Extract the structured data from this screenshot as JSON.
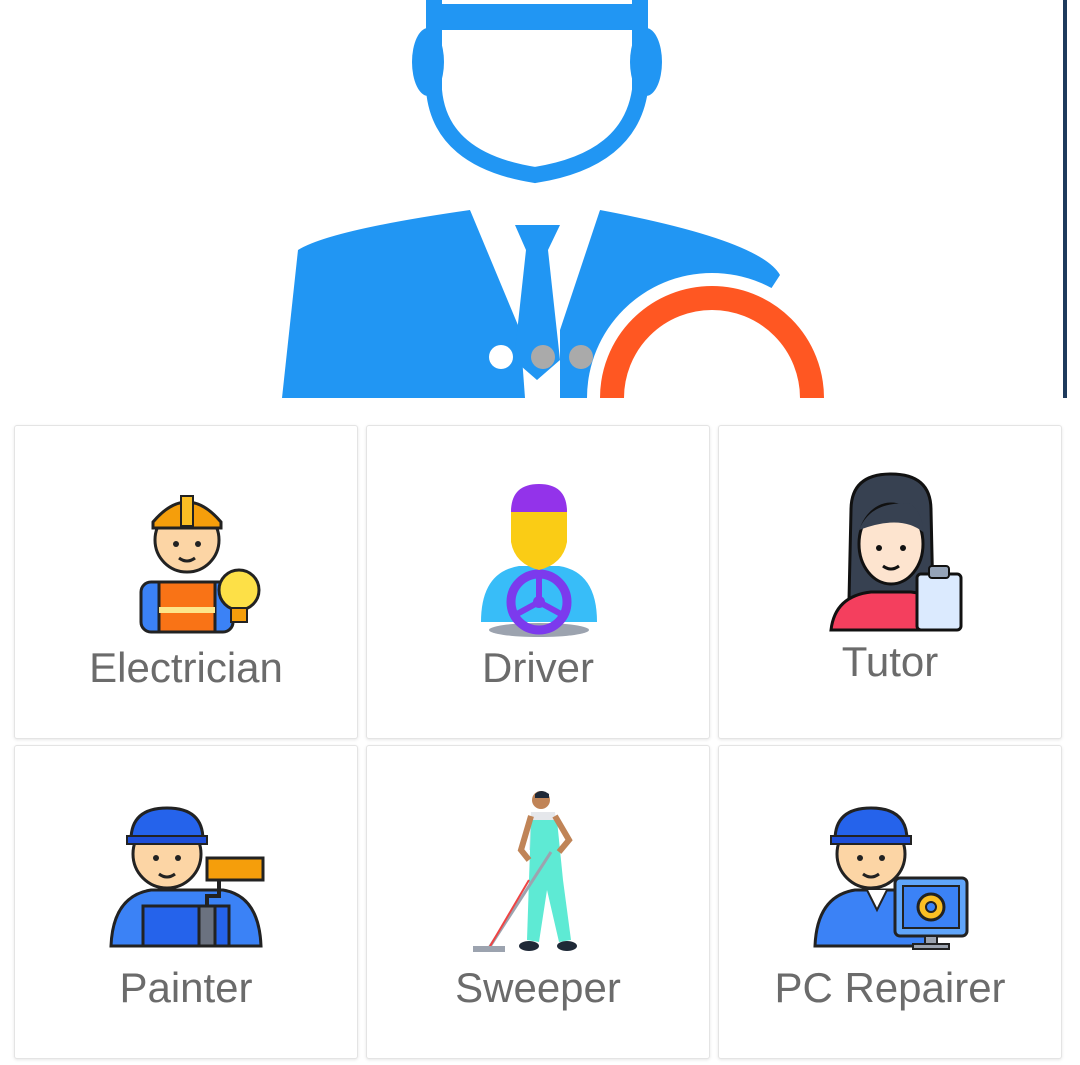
{
  "banner": {
    "slide_count": 3,
    "active_slide": 0,
    "colors": {
      "figure": "#2196F3",
      "accent": "#FF5722",
      "dot_active": "#ffffff",
      "dot_inactive": "#aaaaaa"
    }
  },
  "services": [
    {
      "label": "Electrician",
      "icon": "electrician-icon"
    },
    {
      "label": "Driver",
      "icon": "driver-icon"
    },
    {
      "label": "Tutor",
      "icon": "tutor-icon"
    },
    {
      "label": "Painter",
      "icon": "painter-icon"
    },
    {
      "label": "Sweeper",
      "icon": "sweeper-icon"
    },
    {
      "label": "PC Repairer",
      "icon": "pc-repairer-icon"
    }
  ]
}
